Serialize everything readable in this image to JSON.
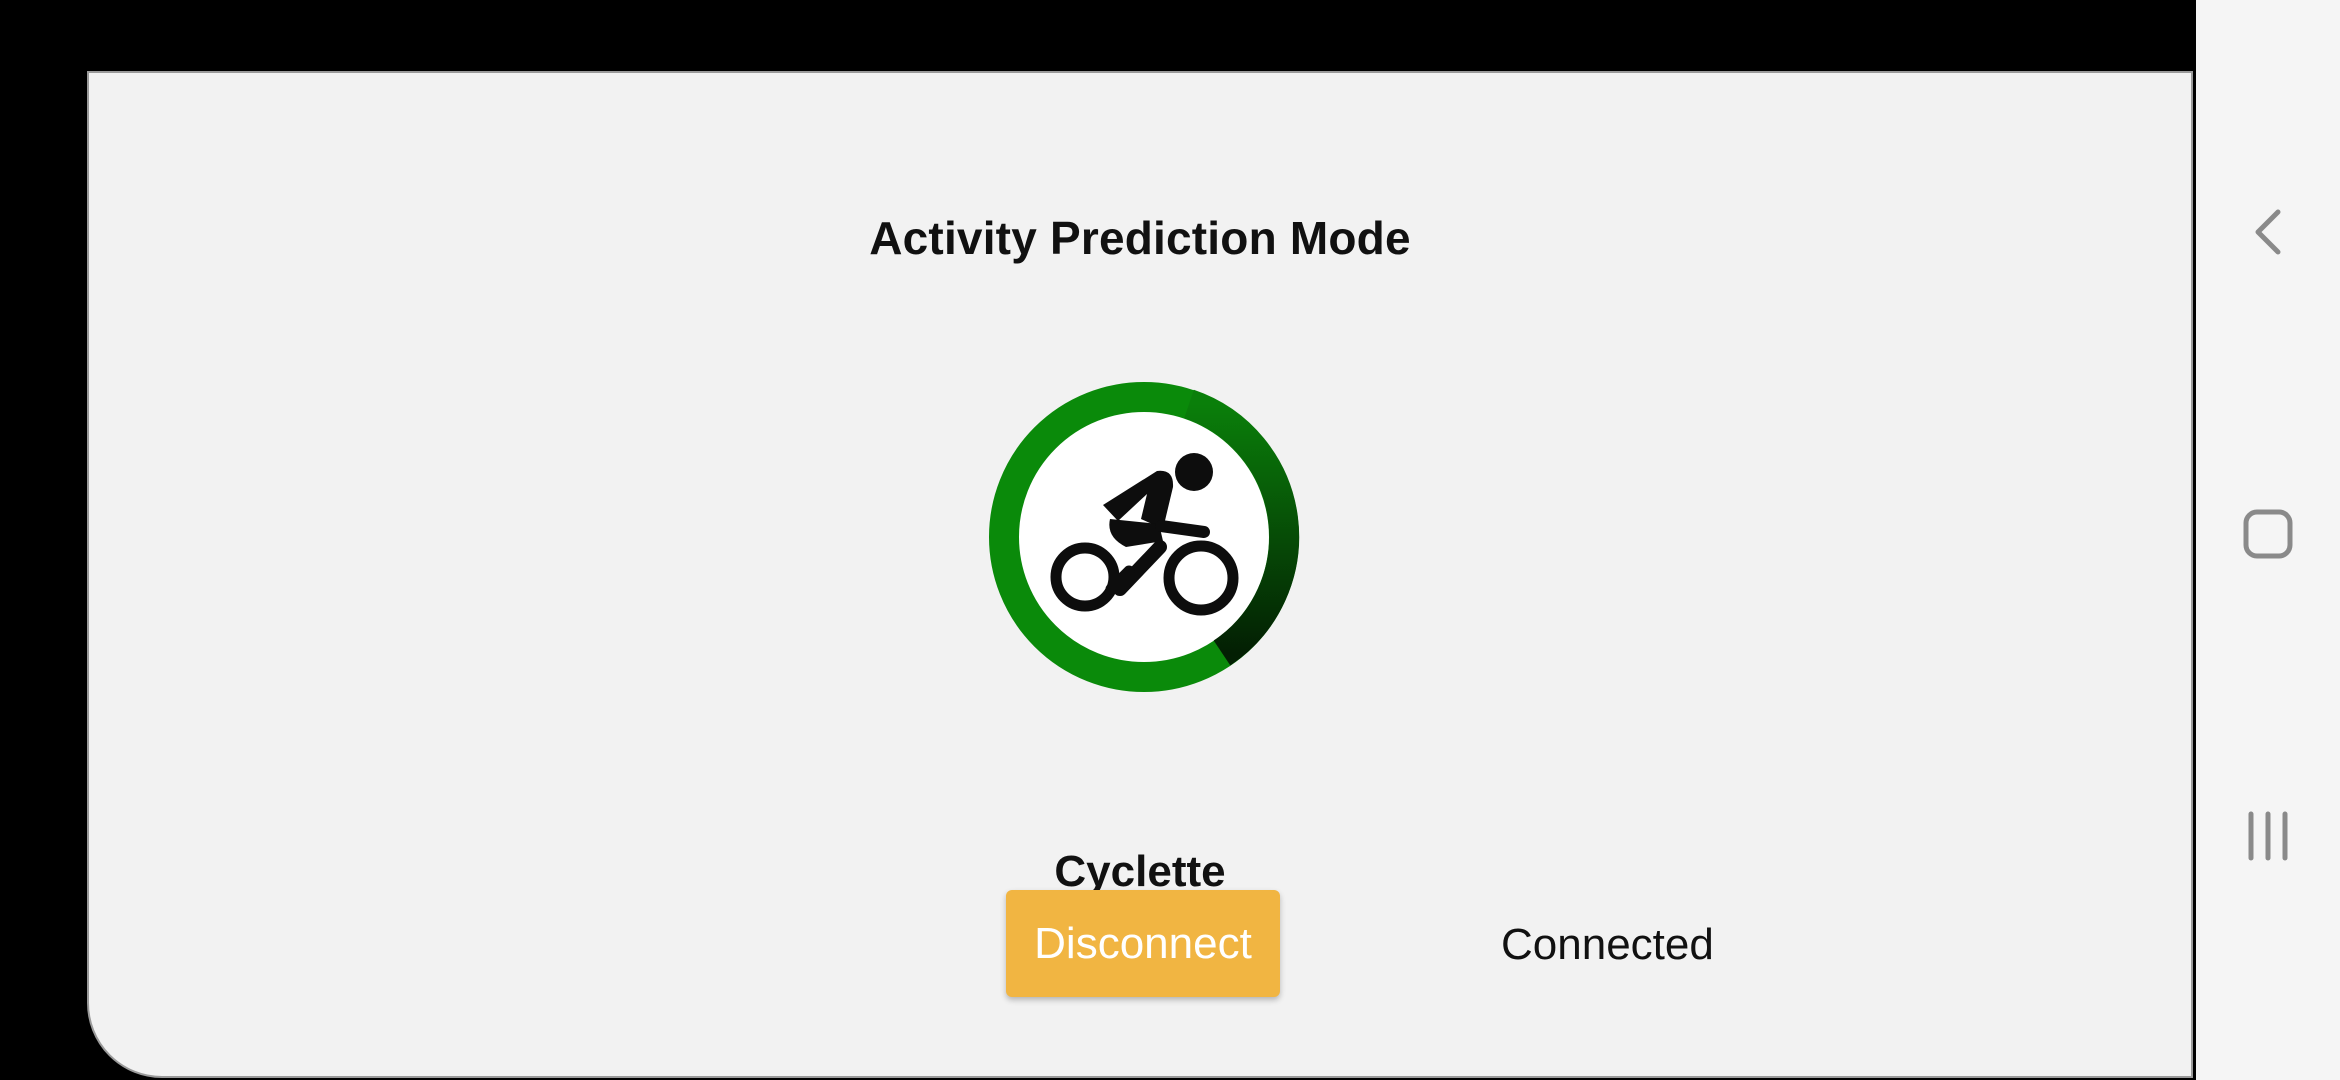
{
  "screen": {
    "title": "Activity Prediction Mode",
    "activity": {
      "label": "Cyclette",
      "icon": "cycling-icon",
      "confidence_ring_color": "#0a8a0a",
      "confidence_ring_remaining_color": "#052f05"
    },
    "controls": {
      "disconnect_label": "Disconnect",
      "disconnect_color": "#f1b542",
      "status_text": "Connected"
    }
  },
  "nav_bar": {
    "icons": [
      "back-icon",
      "home-icon",
      "recents-icon"
    ]
  }
}
